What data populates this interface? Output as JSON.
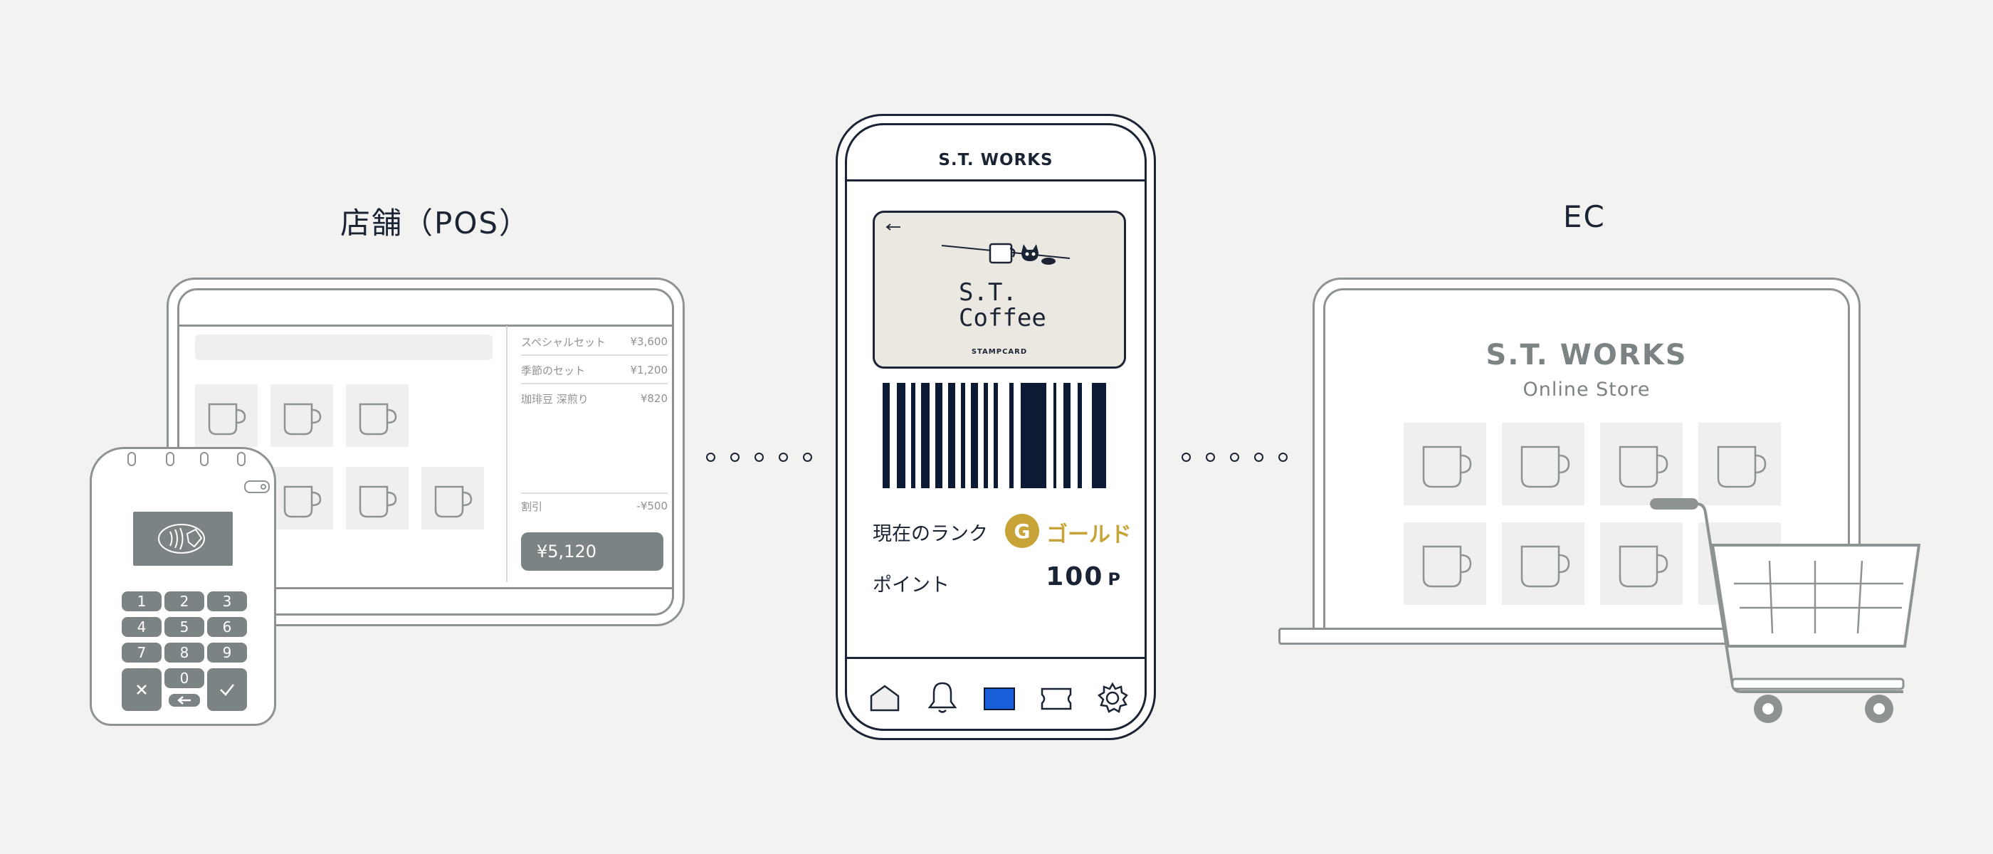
{
  "pos": {
    "title": "店舗（POS）",
    "items": [
      {
        "name": "スペシャルセット",
        "price": "¥3,600"
      },
      {
        "name": "季節のセット",
        "price": "¥1,200"
      },
      {
        "name": "珈琲豆 深煎り",
        "price": "¥820"
      }
    ],
    "discount": {
      "label": "割引",
      "amount": "-¥500"
    },
    "total": "¥5,120"
  },
  "terminal": {
    "keys": [
      "1",
      "2",
      "3",
      "4",
      "5",
      "6",
      "7",
      "8",
      "9",
      "0"
    ],
    "cancel_icon": "close-icon",
    "confirm_icon": "check-icon",
    "back_icon": "backspace-arrow-icon"
  },
  "app": {
    "title": "S.T. WORKS",
    "card": {
      "line1": "S.T.",
      "line2": "Coffee",
      "label": "STAMPCARD"
    },
    "rank_label": "現在のランク",
    "rank_badge": "G",
    "rank_value": "ゴールド",
    "points_label": "ポイント",
    "points_value": "100",
    "points_unit": "P",
    "nav": [
      "home-icon",
      "bell-icon",
      "card-icon",
      "ticket-icon",
      "gear-icon"
    ],
    "colors": {
      "accent": "#1a5fd9",
      "gold": "#c8a338",
      "navy": "#0d1a33"
    }
  },
  "ec": {
    "title": "EC",
    "store_title": "S.T. WORKS",
    "store_subtitle": "Online Store"
  }
}
